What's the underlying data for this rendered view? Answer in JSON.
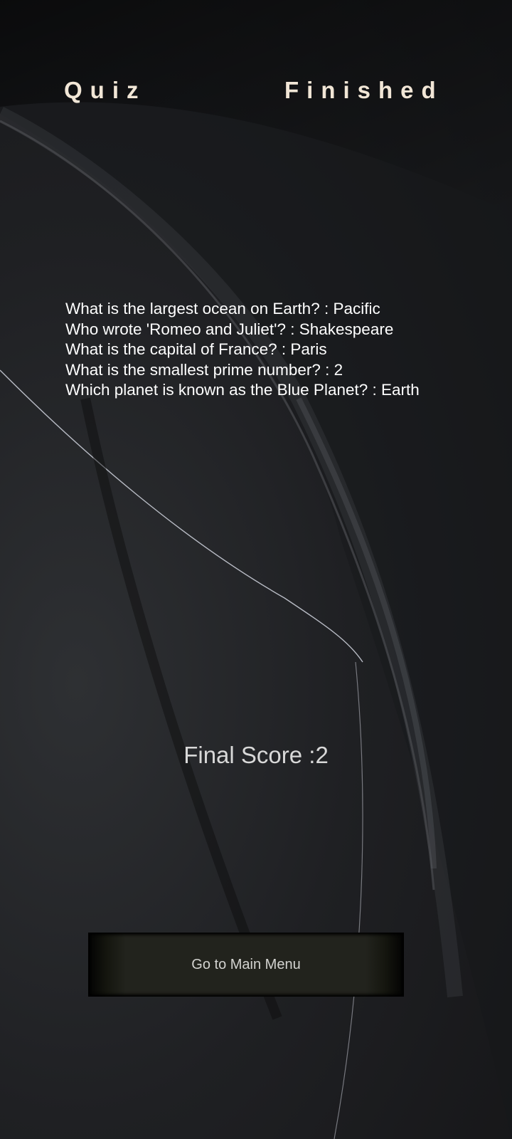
{
  "title": {
    "left": "Quiz",
    "right": "Finished"
  },
  "results": [
    {
      "text": "What is the largest ocean on Earth? : Pacific"
    },
    {
      "text": "Who wrote 'Romeo and Juliet'? : Shakespeare"
    },
    {
      "text": "What is the capital of France? : Paris"
    },
    {
      "text": "What is the smallest prime number? : 2"
    },
    {
      "text": "Which planet is known as the Blue Planet? : Earth"
    }
  ],
  "score": {
    "text": "Final Score :2"
  },
  "actions": {
    "main_menu_label": "Go to Main Menu"
  },
  "colors": {
    "title": "#f1e6d6",
    "text": "#ffffff",
    "score": "#d8d8d8",
    "button_bg": "#22231d",
    "background": "#1f2023"
  }
}
